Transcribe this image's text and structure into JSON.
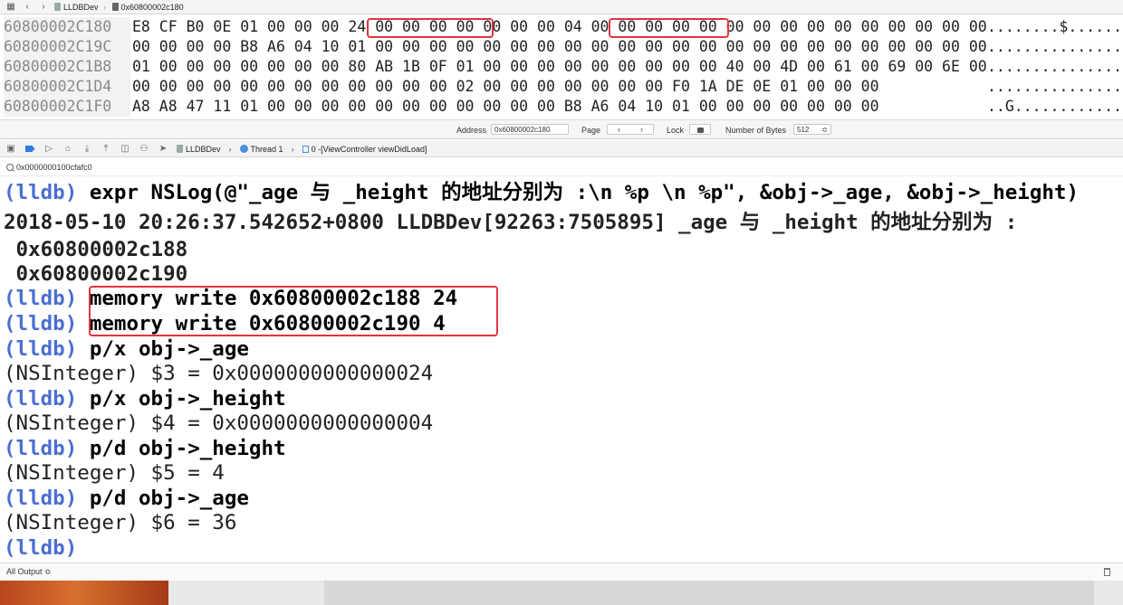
{
  "memory_toolbar": {
    "crumbs": [
      "LLDBDev",
      "0x60800002c180"
    ]
  },
  "hex": {
    "rows": [
      {
        "addr": "60800002C180",
        "bytes": "E8 CF B0 0E 01 00 00 00 24 00 00 00 00 00 00 00 04 00 00 00 00 00 00 00 00 00 00 00 00 00 00 00",
        "ascii": "........$......."
      },
      {
        "addr": "60800002C19C",
        "bytes": "00 00 00 00 B8 A6 04 10 01 00 00 00 00 00 00 00 00 00 00 00 00 00 00 00 00 00 00 00 00 00 00 00",
        "ascii": "................"
      },
      {
        "addr": "60800002C1B8",
        "bytes": "01 00 00 00 00 00 00 00 80 AB 1B 0F 01 00 00 00 00 00 00 00 00 00 40 00 4D 00 61 00 69 00 6E 00",
        "ascii": "................"
      },
      {
        "addr": "60800002C1D4",
        "bytes": "00 00 00 00 00 00 00 00 00 00 00 00 02 00 00 00 00 00 00 00 F0 1A DE 0E 01 00 00 00",
        "ascii": "................"
      },
      {
        "addr": "60800002C1F0",
        "bytes": "A8 A8 47 11 01 00 00 00 00 00 00 00 00 00 00 00 B8 A6 04 10 01 00 00 00 00 00 00 00",
        "ascii": "..G............."
      }
    ]
  },
  "mem_status": {
    "address_label": "Address",
    "address_value": "0x60800002c180",
    "page_label": "Page",
    "lock_label": "Lock",
    "bytes_label": "Number of Bytes",
    "bytes_value": "512"
  },
  "debug_bar": {
    "crumbs": [
      "LLDBDev",
      "Thread 1",
      "0 -[ViewController viewDidLoad]"
    ]
  },
  "var_bar": {
    "value": "0x0000000100cfafc0"
  },
  "console": {
    "prompt": "(lldb)",
    "lines": [
      {
        "type": "cmd",
        "text": "expr NSLog(@\"_age 与 _height 的地址分别为 :\\n %p \\n %p\", &obj->_age, &obj->_height)"
      },
      {
        "type": "out_bold",
        "text": "2018-05-10 20:26:37.542652+0800 LLDBDev[92263:7505895] _age 与 _height 的地址分别为 :"
      },
      {
        "type": "out_bold",
        "text": " 0x60800002c188"
      },
      {
        "type": "out_bold",
        "text": " 0x60800002c190"
      },
      {
        "type": "cmd",
        "text": "memory write 0x60800002c188 24"
      },
      {
        "type": "cmd",
        "text": "memory write 0x60800002c190 4"
      },
      {
        "type": "cmd",
        "text": "p/x obj->_age"
      },
      {
        "type": "out",
        "text": "(NSInteger) $3 = 0x0000000000000024"
      },
      {
        "type": "cmd",
        "text": "p/x obj->_height"
      },
      {
        "type": "out",
        "text": "(NSInteger) $4 = 0x0000000000000004"
      },
      {
        "type": "cmd",
        "text": "p/d obj->_height"
      },
      {
        "type": "out",
        "text": "(NSInteger) $5 = 4"
      },
      {
        "type": "cmd",
        "text": "p/d obj->_age"
      },
      {
        "type": "out",
        "text": "(NSInteger) $6 = 36"
      },
      {
        "type": "prompt_only",
        "text": ""
      }
    ]
  },
  "footer": {
    "output_label": "All Output ≎"
  },
  "colors": {
    "highlight": "#e0343f",
    "prompt": "#4a6fd1"
  }
}
